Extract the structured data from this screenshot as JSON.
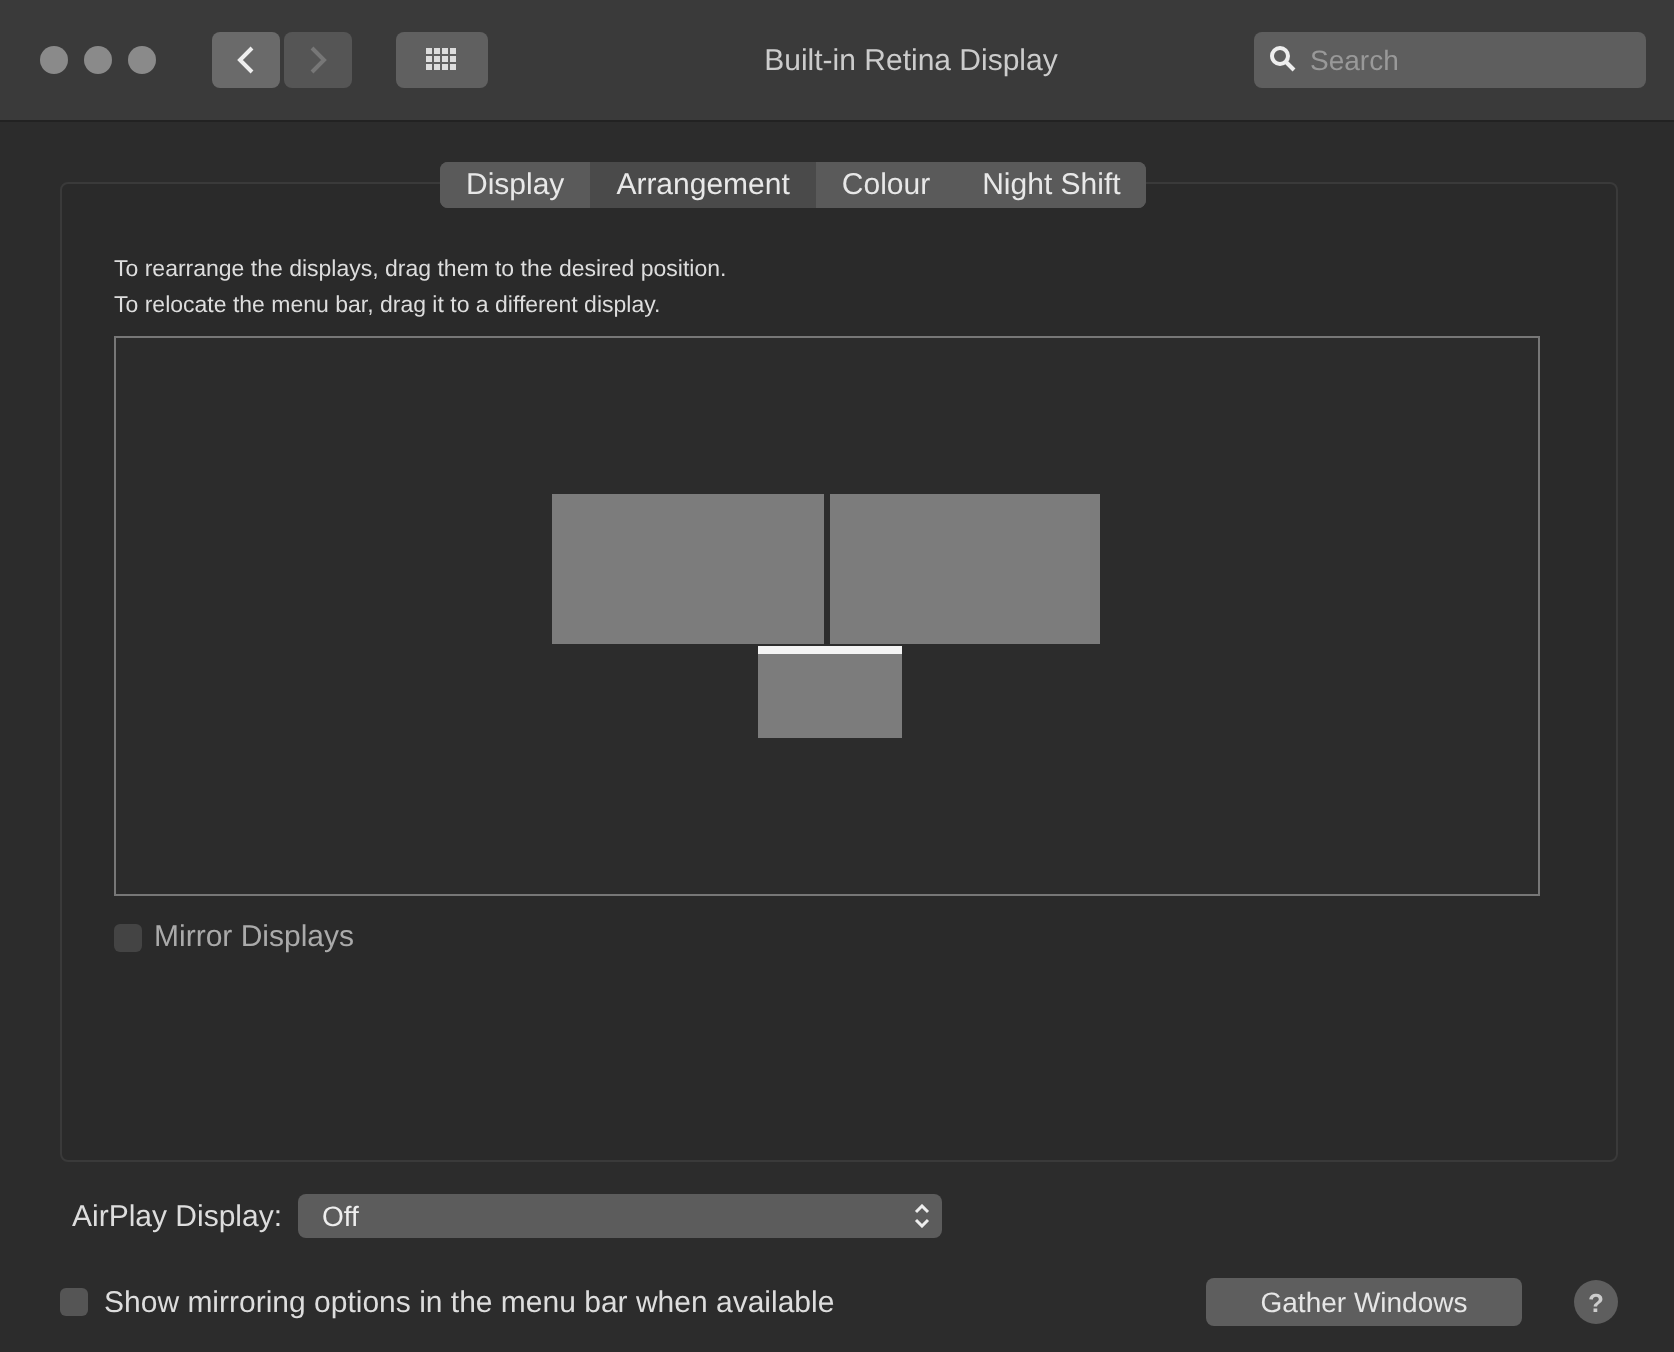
{
  "window": {
    "title": "Built-in Retina Display"
  },
  "search": {
    "placeholder": "Search"
  },
  "tabs": [
    {
      "label": "Display",
      "selected": false
    },
    {
      "label": "Arrangement",
      "selected": true
    },
    {
      "label": "Colour",
      "selected": false
    },
    {
      "label": "Night Shift",
      "selected": false
    }
  ],
  "instructions": [
    "To rearrange the displays, drag them to the desired position.",
    "To relocate the menu bar, drag it to a different display."
  ],
  "displays": [
    {
      "menu_bar": false
    },
    {
      "menu_bar": false
    },
    {
      "menu_bar": true
    }
  ],
  "mirror_displays": {
    "label": "Mirror Displays",
    "checked": false,
    "disabled": true
  },
  "airplay": {
    "label": "AirPlay Display:",
    "value": "Off"
  },
  "show_mirroring": {
    "label": "Show mirroring options in the menu bar when available",
    "checked": false
  },
  "gather_button": "Gather Windows",
  "help_button": "?"
}
